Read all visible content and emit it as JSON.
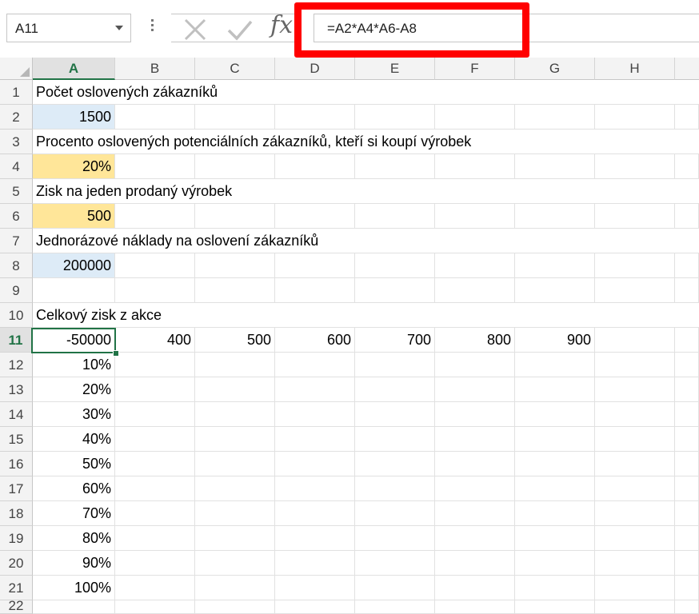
{
  "formula_bar": {
    "name_box": "A11",
    "formula": "=A2*A4*A6-A8",
    "fx_label": "fx"
  },
  "columns": [
    "A",
    "B",
    "C",
    "D",
    "E",
    "F",
    "G",
    "H"
  ],
  "selected_column": "A",
  "rows": [
    "1",
    "2",
    "3",
    "4",
    "5",
    "6",
    "7",
    "8",
    "9",
    "10",
    "11",
    "12",
    "13",
    "14",
    "15",
    "16",
    "17",
    "18",
    "19",
    "20",
    "21",
    "22"
  ],
  "selected_row": "11",
  "cells": {
    "A1": "Počet oslovených zákazníků",
    "A2": "1500",
    "A3": "Procento oslovených potenciálních zákazníků, kteří si koupí výrobek",
    "A4": "20%",
    "A5": "Zisk na jeden prodaný výrobek",
    "A6": "500",
    "A7": "Jednorázové náklady na oslovení zákazníků",
    "A8": "200000",
    "A10": "Celkový zisk z akce",
    "A11": "-50000",
    "B11": "400",
    "C11": "500",
    "D11": "600",
    "E11": "700",
    "F11": "800",
    "G11": "900",
    "A12": "10%",
    "A13": "20%",
    "A14": "30%",
    "A15": "40%",
    "A16": "50%",
    "A17": "60%",
    "A18": "70%",
    "A19": "80%",
    "A20": "90%",
    "A21": "100%"
  },
  "colors": {
    "accent": "#217346",
    "input_fill": "#ddebf7",
    "variable_fill": "#ffe699",
    "highlight": "#ff0000"
  }
}
